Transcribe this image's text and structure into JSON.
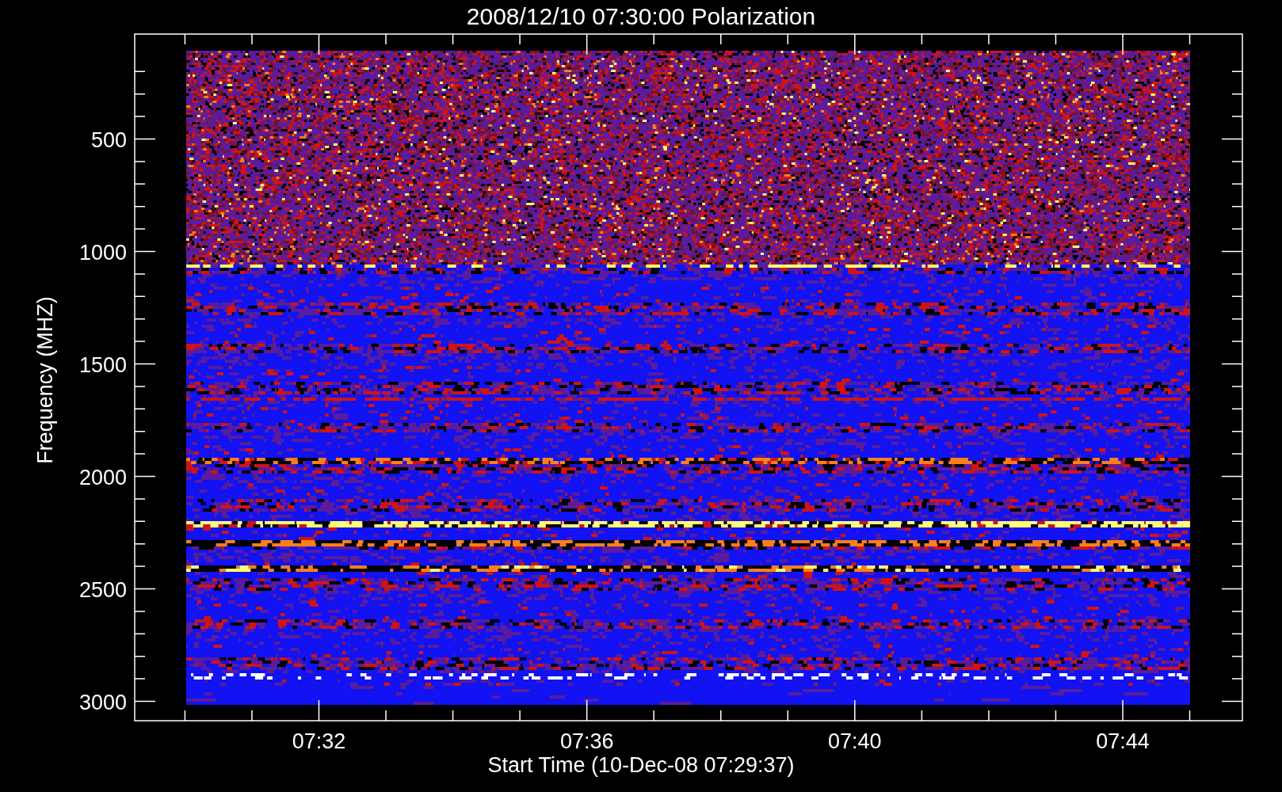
{
  "title": "2008/12/10 07:30:00 Polarization",
  "y_axis": {
    "label": "Frequency (MHZ)",
    "ticks": [
      "500",
      "1000",
      "1500",
      "2000",
      "2500",
      "3000"
    ]
  },
  "x_axis": {
    "label": "Start Time (10-Dec-08 07:29:37)",
    "ticks": [
      "07:32",
      "07:36",
      "07:40",
      "07:44"
    ]
  }
}
